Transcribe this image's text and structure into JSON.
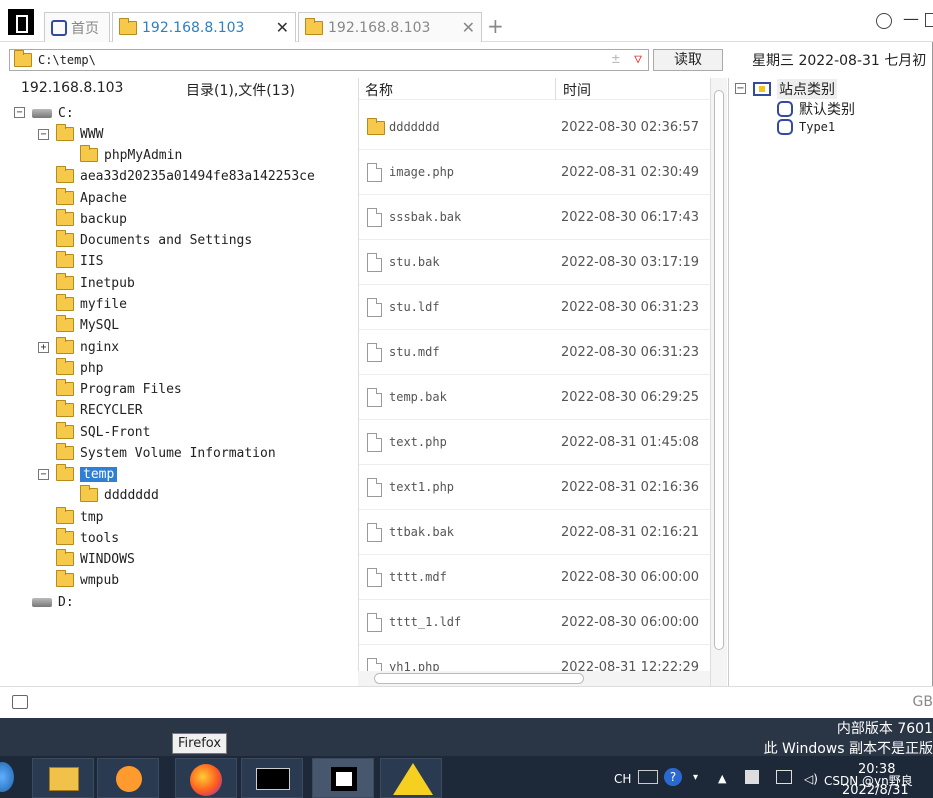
{
  "tabs": [
    {
      "label": "首页"
    },
    {
      "label": "192.168.8.103"
    },
    {
      "label": "192.168.8.103"
    }
  ],
  "toolbar": {
    "add_tab": "+",
    "path": "C:\\temp\\",
    "read_label": "读取",
    "date_text": "星期三  2022-08-31  七月初",
    "pm": "±",
    "dd": "▽"
  },
  "left": {
    "host": "192.168.8.103",
    "summary": "目录(1),文件(13)",
    "drive_c": "C:",
    "drive_d": "D:",
    "folders": [
      "WWW",
      "phpMyAdmin",
      "aea33d20235a01494fe83a142253ce",
      "Apache",
      "backup",
      "Documents and Settings",
      "IIS",
      "Inetpub",
      "myfile",
      "MySQL",
      "nginx",
      "php",
      "Program Files",
      "RECYCLER",
      "SQL-Front",
      "System Volume Information",
      "temp",
      "ddddddd",
      "tmp",
      "tools",
      "WINDOWS",
      "wmpub"
    ]
  },
  "filelist": {
    "col_name": "名称",
    "col_time": "时间",
    "rows": [
      {
        "name": "ddddddd",
        "time": "2022-08-30 02:36:57",
        "type": "folder"
      },
      {
        "name": "image.php",
        "time": "2022-08-31 02:30:49",
        "type": "file"
      },
      {
        "name": "sssbak.bak",
        "time": "2022-08-30 06:17:43",
        "type": "file"
      },
      {
        "name": "stu.bak",
        "time": "2022-08-30 03:17:19",
        "type": "file"
      },
      {
        "name": "stu.ldf",
        "time": "2022-08-30 06:31:23",
        "type": "file"
      },
      {
        "name": "stu.mdf",
        "time": "2022-08-30 06:31:23",
        "type": "file"
      },
      {
        "name": "temp.bak",
        "time": "2022-08-30 06:29:25",
        "type": "file"
      },
      {
        "name": "text.php",
        "time": "2022-08-31 01:45:08",
        "type": "file"
      },
      {
        "name": "text1.php",
        "time": "2022-08-31 02:16:36",
        "type": "file"
      },
      {
        "name": "ttbak.bak",
        "time": "2022-08-31 02:16:21",
        "type": "file"
      },
      {
        "name": "tttt.mdf",
        "time": "2022-08-30 06:00:00",
        "type": "file"
      },
      {
        "name": "tttt_1.ldf",
        "time": "2022-08-30 06:00:00",
        "type": "file"
      },
      {
        "name": "yh1.php",
        "time": "2022-08-31 12:22:29",
        "type": "file"
      }
    ]
  },
  "right": {
    "root": "站点类别",
    "items": [
      "默认类别",
      "Type1"
    ]
  },
  "status": {
    "encoding": "GB"
  },
  "watermark": {
    "line1": "内部版本 7601",
    "line2": "此 Windows 副本不是正版"
  },
  "taskbar": {
    "tooltip": "Firefox",
    "lang": "CH",
    "clock_time": "20:38",
    "clock_date": "2022/8/31",
    "credit": "CSDN @yn野良"
  }
}
